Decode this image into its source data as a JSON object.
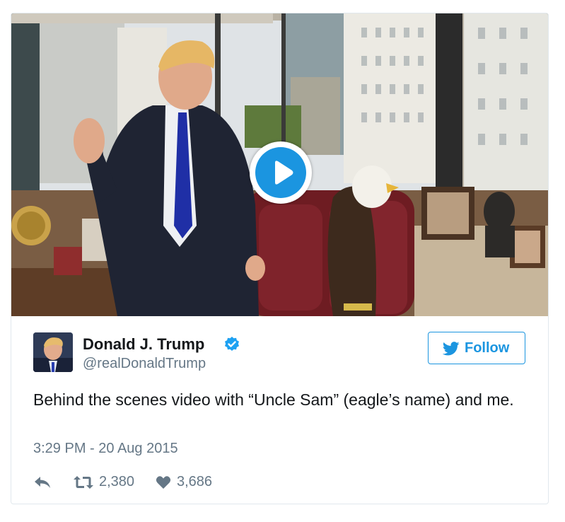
{
  "media": {
    "kind": "video",
    "play_icon": "play-icon"
  },
  "author": {
    "name": "Donald J. Trump",
    "handle": "@realDonaldTrump",
    "verified_icon": "verified-badge-icon"
  },
  "follow_button": {
    "label": "Follow",
    "icon": "twitter-bird-icon"
  },
  "tweet": {
    "text": "Behind the scenes video with “Uncle Sam” (eagle’s name) and me.",
    "timestamp": "3:29 PM - 20 Aug 2015"
  },
  "actions": {
    "reply_icon": "reply-icon",
    "retweet_icon": "retweet-icon",
    "retweet_count": "2,380",
    "like_icon": "heart-icon",
    "like_count": "3,686"
  },
  "colors": {
    "accent": "#1b95e0",
    "text": "#14171a",
    "muted": "#657786",
    "border": "#e1e8ed"
  }
}
